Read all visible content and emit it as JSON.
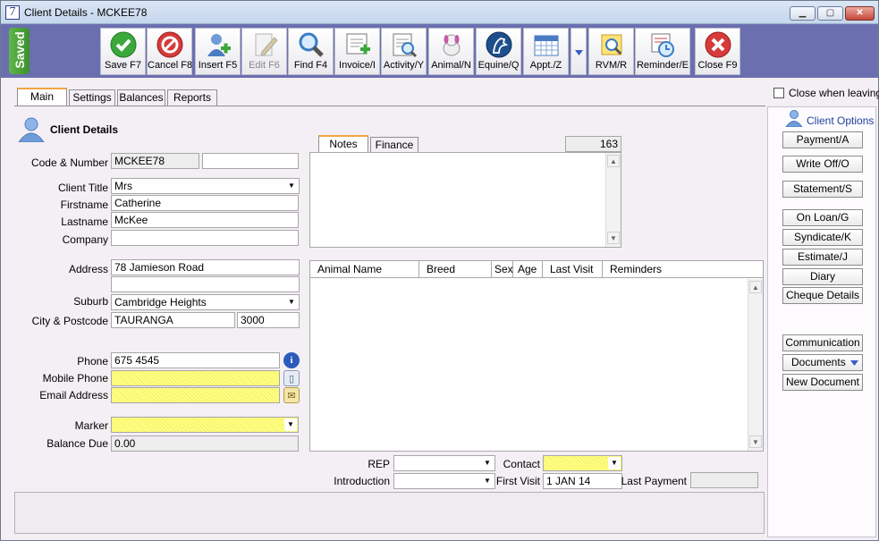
{
  "window": {
    "title": "Client Details - MCKEE78",
    "app_icon_text": "7"
  },
  "toolbar": {
    "saved_label": "Saved",
    "buttons": [
      {
        "label": "Save F7",
        "icon": "checkmark-icon",
        "color": "#3aa83a"
      },
      {
        "label": "Cancel F8",
        "icon": "cancel-icon",
        "color": "#d63a3a"
      },
      {
        "label": "Insert F5",
        "icon": "insert-person-icon",
        "color": "#4a7cc4"
      },
      {
        "label": "Edit F6",
        "icon": "edit-pencil-icon",
        "color": "#b0b0b0",
        "disabled": true
      },
      {
        "label": "Find F4",
        "icon": "magnifier-icon",
        "color": "#3a7cc4"
      },
      {
        "label": "Invoice/I",
        "icon": "invoice-icon",
        "color": "#4aa84a"
      },
      {
        "label": "Activity/Y",
        "icon": "activity-icon",
        "color": "#4a7cc4"
      },
      {
        "label": "Animal/N",
        "icon": "animal-dog-icon",
        "color": "#c45aa8"
      },
      {
        "label": "Equine/Q",
        "icon": "equine-horse-icon",
        "color": "#1d4f8c"
      },
      {
        "label": "Appt./Z",
        "icon": "calendar-icon",
        "color": "#4a7cc4"
      },
      {
        "label": "RVM/R",
        "icon": "rvm-magnifier-icon",
        "color": "#e0a020"
      },
      {
        "label": "Reminder/E",
        "icon": "reminder-clock-icon",
        "color": "#4a7cc4"
      },
      {
        "label": "Close F9",
        "icon": "close-icon",
        "color": "#d63a3a"
      }
    ]
  },
  "tabs": [
    "Main",
    "Settings",
    "Balances",
    "Reports"
  ],
  "close_when_leaving": "Close when leaving",
  "client": {
    "section_title": "Client Details",
    "code_label": "Code & Number",
    "code_value": "MCKEE78",
    "number_value": "",
    "title_label": "Client Title",
    "title_value": "Mrs",
    "firstname_label": "Firstname",
    "firstname_value": "Catherine",
    "lastname_label": "Lastname",
    "lastname_value": "McKee",
    "company_label": "Company",
    "company_value": "",
    "address_label": "Address",
    "address_line1": "78 Jamieson Road",
    "address_line2": "",
    "suburb_label": "Suburb",
    "suburb_value": "Cambridge Heights",
    "city_label": "City & Postcode",
    "city_value": "TAURANGA",
    "postcode_value": "3000",
    "phone_label": "Phone",
    "phone_value": "675 4545",
    "mobile_label": "Mobile Phone",
    "mobile_value": "",
    "email_label": "Email Address",
    "email_value": "",
    "marker_label": "Marker",
    "marker_value": "",
    "balance_label": "Balance Due",
    "balance_value": "0.00"
  },
  "notes": {
    "tabs": [
      "Notes",
      "Finance"
    ],
    "count": "163",
    "text": ""
  },
  "animals": {
    "columns": [
      "Animal Name",
      "Breed",
      "Sex",
      "Age",
      "Last Visit",
      "Reminders"
    ],
    "rows": []
  },
  "footer": {
    "rep_label": "REP",
    "rep_value": "",
    "contact_label": "Contact",
    "contact_value": "",
    "intro_label": "Introduction",
    "intro_value": "",
    "first_visit_label": "First Visit",
    "first_visit_value": "1 JAN 14",
    "last_payment_label": "Last Payment",
    "last_payment_value": ""
  },
  "client_options": {
    "title": "Client Options",
    "buttons": [
      "Payment/A",
      "Write Off/O",
      "Statement/S",
      "On Loan/G",
      "Syndicate/K",
      "Estimate/J",
      "Diary",
      "Cheque Details",
      "Communication",
      "Documents",
      "New Document"
    ]
  }
}
